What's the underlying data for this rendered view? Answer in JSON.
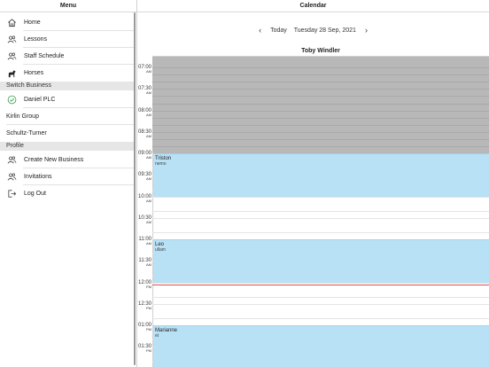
{
  "sidebar": {
    "title": "Menu",
    "items": [
      {
        "label": "Home",
        "icon": "home-icon"
      },
      {
        "label": "Lessons",
        "icon": "people-icon"
      },
      {
        "label": "Staff Schedule",
        "icon": "people-icon"
      },
      {
        "label": "Horses",
        "icon": "horse-icon"
      }
    ],
    "switch_business": {
      "title": "Switch Business",
      "items": [
        {
          "label": "Daniel PLC",
          "selected": true
        },
        {
          "label": "Kirlin Group"
        },
        {
          "label": "Schultz-Turner"
        }
      ]
    },
    "profile": {
      "title": "Profile",
      "items": [
        {
          "label": "Create New Business",
          "icon": "people-icon"
        },
        {
          "label": "Invitations",
          "icon": "people-icon"
        },
        {
          "label": "Log Out",
          "icon": "logout-icon"
        }
      ]
    }
  },
  "calendar": {
    "title": "Calendar",
    "today_label": "Today",
    "date_label": "Tuesday 28 Sep, 2021",
    "resource": "Toby Windler",
    "time_slots": [
      {
        "time": "07:00",
        "ampm": "AM"
      },
      {
        "time": "07:30",
        "ampm": "AM"
      },
      {
        "time": "08:00",
        "ampm": "AM"
      },
      {
        "time": "08:30",
        "ampm": "AM"
      },
      {
        "time": "09:00",
        "ampm": "AM"
      },
      {
        "time": "09:30",
        "ampm": "AM"
      },
      {
        "time": "10:00",
        "ampm": "AM"
      },
      {
        "time": "10:30",
        "ampm": "AM"
      },
      {
        "time": "11:00",
        "ampm": "AM"
      },
      {
        "time": "11:30",
        "ampm": "AM"
      },
      {
        "time": "12:00",
        "ampm": "PM"
      },
      {
        "time": "12:30",
        "ampm": "PM"
      },
      {
        "time": "01:00",
        "ampm": "PM"
      },
      {
        "time": "01:30",
        "ampm": "PM"
      }
    ],
    "events": [
      {
        "name": "Triston",
        "note": "nemo",
        "start": "09:00",
        "end": "10:00"
      },
      {
        "name": "Leo",
        "note": "ullam",
        "start": "11:00",
        "end": "12:00"
      },
      {
        "name": "Marianne",
        "note": "et",
        "start": "13:00",
        "end": "14:00"
      }
    ],
    "unavailable": {
      "start": "06:45",
      "end": "09:00"
    },
    "current_time": "12:03",
    "colors": {
      "event": "#b9e1f5",
      "unavailable": "#b8b8b8",
      "now_line": "#d9534f"
    }
  }
}
